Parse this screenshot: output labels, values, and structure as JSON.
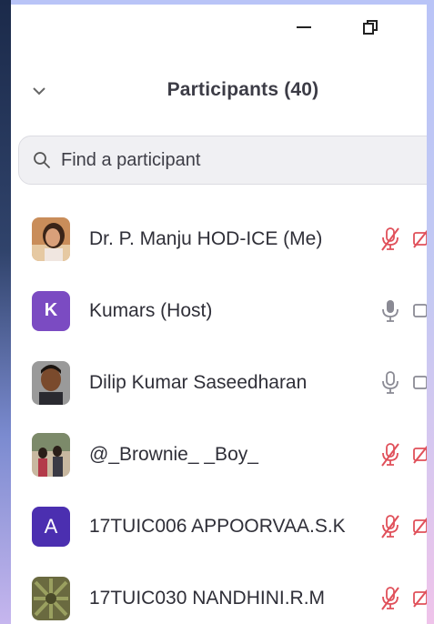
{
  "window_controls": {
    "minimize_icon": "minimize-icon",
    "restore_icon": "restore-icon"
  },
  "header": {
    "title": "Participants (40)",
    "collapse_icon": "chevron-down-icon"
  },
  "search": {
    "placeholder": "Find a participant",
    "icon": "search-icon"
  },
  "colors": {
    "muted": "#e0505a",
    "unmuted": "#8a8a94",
    "host_avatar": "#7b4bc2",
    "letter_avatar": "#4b2fb0"
  },
  "participants": [
    {
      "name": "Dr. P. Manju HOD-ICE (Me)",
      "avatar": "photo",
      "mic": "muted",
      "video": "off"
    },
    {
      "name": "Kumars (Host)",
      "avatar": "K",
      "mic": "on",
      "video": "on"
    },
    {
      "name": "Dilip Kumar Saseedharan",
      "avatar": "photo",
      "mic": "on",
      "video": "on"
    },
    {
      "name": "@_Brownie_ _Boy_",
      "avatar": "photo",
      "mic": "muted",
      "video": "off"
    },
    {
      "name": "17TUIC006 APPOORVAA.S.K",
      "avatar": "A",
      "mic": "muted",
      "video": "off"
    },
    {
      "name": "17TUIC030 NANDHINI.R.M",
      "avatar": "photo",
      "mic": "muted",
      "video": "off"
    }
  ]
}
